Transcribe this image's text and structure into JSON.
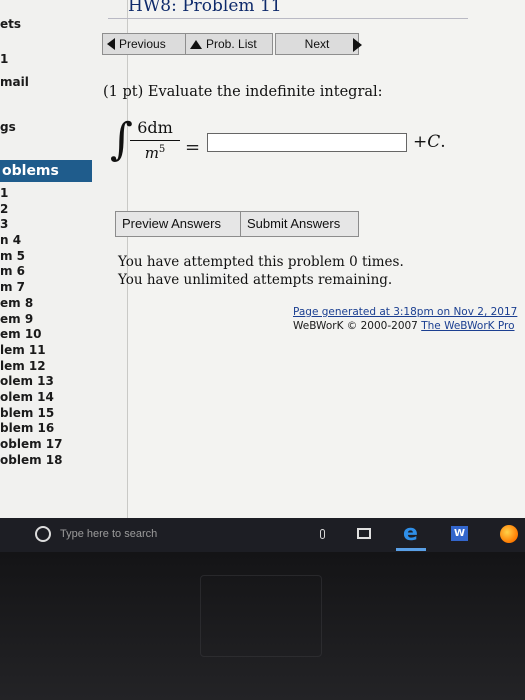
{
  "sidebar": {
    "sets_label": "ets",
    "item_1": "1",
    "mail_label": "mail",
    "gs_label": "gs",
    "problems_header": "oblems",
    "problems": [
      "1",
      "2",
      "3",
      "n 4",
      "m 5",
      "m 6",
      "m 7",
      "em 8",
      "em 9",
      "em 10",
      "lem 11",
      "lem 12",
      "olem 13",
      "olem 14",
      "blem 15",
      "blem 16",
      "oblem 17",
      "oblem 18"
    ]
  },
  "header": {
    "title": "HW8: Problem 11"
  },
  "nav": {
    "previous": "Previous",
    "prob_list": "Prob. List",
    "next": "Next"
  },
  "problem": {
    "statement": "(1 pt) Evaluate the indefinite integral:",
    "integral_sign": "∫",
    "numerator": "6dm",
    "denominator_base": "m",
    "denominator_exp": "5",
    "equals": "=",
    "answer_value": "",
    "plus_c_prefix": "+",
    "plus_c_var": "C",
    "plus_c_suffix": "."
  },
  "actions": {
    "preview": "Preview Answers",
    "submit": "Submit Answers"
  },
  "attempts": {
    "line1": "You have attempted this problem 0 times.",
    "line2": "You have unlimited attempts remaining."
  },
  "footer": {
    "generated": "Page generated at 3:18pm on Nov 2, 2017",
    "copyright": "WeBWorK © 2000-2007",
    "link": "The WeBWorK Pro"
  },
  "taskbar": {
    "search_placeholder": "Type here to search",
    "edge_glyph": "e",
    "word_glyph": "W"
  },
  "colors": {
    "sidebar_header_bg": "#1f5c8c",
    "title_color": "#0e2a6b",
    "link_color": "#1b3f91",
    "taskbar_bg": "#1d1e24"
  }
}
